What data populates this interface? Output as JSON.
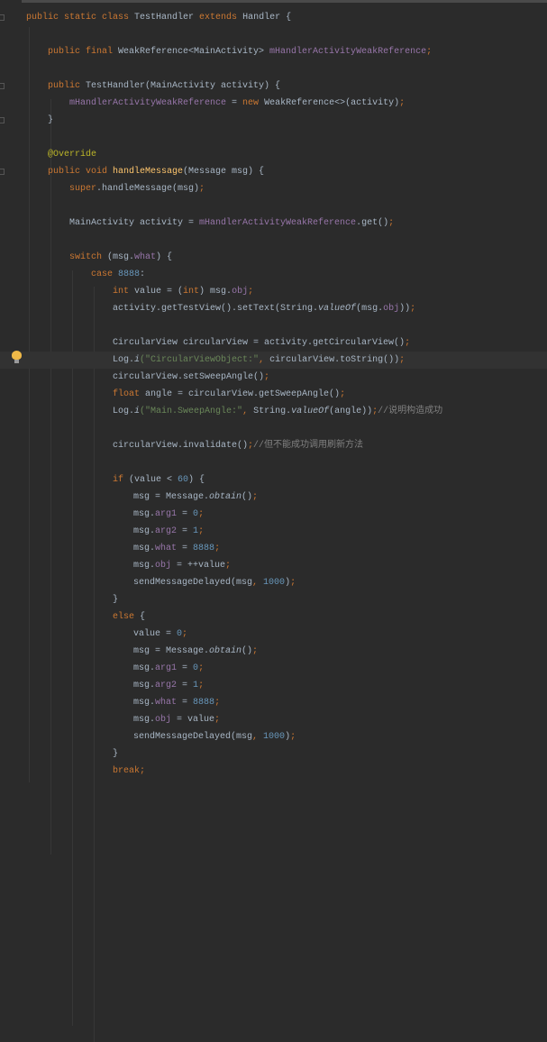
{
  "editor": {
    "highlighted_line": 21,
    "lines": [
      {
        "indent": 0,
        "fold": true,
        "tokens": [
          {
            "t": "public static class ",
            "c": "kw"
          },
          {
            "t": "TestHandler "
          },
          {
            "t": "extends ",
            "c": "kw"
          },
          {
            "t": "Handler {"
          }
        ]
      },
      {
        "indent": 0,
        "tokens": []
      },
      {
        "indent": 1,
        "tokens": [
          {
            "t": "public final ",
            "c": "kw"
          },
          {
            "t": "WeakReference<MainActivity> "
          },
          {
            "t": "mHandlerActivityWeakReference",
            "c": "fld"
          },
          {
            "t": ";",
            "c": "kw"
          }
        ]
      },
      {
        "indent": 0,
        "tokens": []
      },
      {
        "indent": 1,
        "fold": true,
        "tokens": [
          {
            "t": "public ",
            "c": "kw"
          },
          {
            "t": "TestHandler(MainActivity activity) {"
          }
        ]
      },
      {
        "indent": 2,
        "tokens": [
          {
            "t": "mHandlerActivityWeakReference",
            "c": "fld"
          },
          {
            "t": " = "
          },
          {
            "t": "new ",
            "c": "kw"
          },
          {
            "t": "WeakReference<>(activity)"
          },
          {
            "t": ";",
            "c": "kw"
          }
        ]
      },
      {
        "indent": 1,
        "fold": true,
        "tokens": [
          {
            "t": "}"
          }
        ]
      },
      {
        "indent": 0,
        "tokens": []
      },
      {
        "indent": 1,
        "tokens": [
          {
            "t": "@Override",
            "c": "ann"
          }
        ]
      },
      {
        "indent": 1,
        "fold": true,
        "tokens": [
          {
            "t": "public void ",
            "c": "kw"
          },
          {
            "t": "handleMessage",
            "c": "fn"
          },
          {
            "t": "(Message msg) {"
          }
        ]
      },
      {
        "indent": 2,
        "tokens": [
          {
            "t": "super",
            "c": "kw"
          },
          {
            "t": ".handleMessage(msg)"
          },
          {
            "t": ";",
            "c": "kw"
          }
        ]
      },
      {
        "indent": 0,
        "tokens": []
      },
      {
        "indent": 2,
        "tokens": [
          {
            "t": "MainActivity activity = "
          },
          {
            "t": "mHandlerActivityWeakReference",
            "c": "fld"
          },
          {
            "t": ".get()"
          },
          {
            "t": ";",
            "c": "kw"
          }
        ]
      },
      {
        "indent": 0,
        "tokens": []
      },
      {
        "indent": 2,
        "tokens": [
          {
            "t": "switch ",
            "c": "kw"
          },
          {
            "t": "(msg."
          },
          {
            "t": "what",
            "c": "fld"
          },
          {
            "t": ") {"
          }
        ]
      },
      {
        "indent": 3,
        "tokens": [
          {
            "t": "case ",
            "c": "kw"
          },
          {
            "t": "8888",
            "c": "num"
          },
          {
            "t": ":"
          }
        ]
      },
      {
        "indent": 4,
        "tokens": [
          {
            "t": "int ",
            "c": "kw"
          },
          {
            "t": "value = ("
          },
          {
            "t": "int",
            "c": "kw"
          },
          {
            "t": ") msg."
          },
          {
            "t": "obj",
            "c": "fld"
          },
          {
            "t": ";",
            "c": "kw"
          }
        ]
      },
      {
        "indent": 4,
        "tokens": [
          {
            "t": "activity.getTestView().setText(String."
          },
          {
            "t": "valueOf",
            "c": "it"
          },
          {
            "t": "(msg."
          },
          {
            "t": "obj",
            "c": "fld"
          },
          {
            "t": "))"
          },
          {
            "t": ";",
            "c": "kw"
          }
        ]
      },
      {
        "indent": 0,
        "tokens": []
      },
      {
        "indent": 4,
        "tokens": [
          {
            "t": "CircularView circularView = activity.getCircularView()"
          },
          {
            "t": ";",
            "c": "kw"
          }
        ]
      },
      {
        "indent": 4,
        "tokens": [
          {
            "t": "Log."
          },
          {
            "t": "i",
            "c": "it"
          },
          {
            "t": "(\"CircularViewObject:\"",
            "c": "str"
          },
          {
            "t": ", ",
            "c": "kw"
          },
          {
            "t": "circularView.toString())"
          },
          {
            "t": ";",
            "c": "kw"
          }
        ]
      },
      {
        "indent": 4,
        "tokens": [
          {
            "t": "circularView.setSweepAngle()"
          },
          {
            "t": ";",
            "c": "kw"
          }
        ]
      },
      {
        "indent": 4,
        "tokens": [
          {
            "t": "float ",
            "c": "kw"
          },
          {
            "t": "angle = circularView.getSweepAngle()"
          },
          {
            "t": ";",
            "c": "kw"
          }
        ]
      },
      {
        "indent": 4,
        "tokens": [
          {
            "t": "Log."
          },
          {
            "t": "i",
            "c": "it"
          },
          {
            "t": "(\"Main.SweepAngle:\"",
            "c": "str"
          },
          {
            "t": ", ",
            "c": "kw"
          },
          {
            "t": "String."
          },
          {
            "t": "valueOf",
            "c": "it"
          },
          {
            "t": "(angle))"
          },
          {
            "t": ";",
            "c": "kw"
          },
          {
            "t": "//说明构造成功",
            "c": "cmt"
          }
        ]
      },
      {
        "indent": 0,
        "tokens": []
      },
      {
        "indent": 4,
        "tokens": [
          {
            "t": "circularView.invalidate()"
          },
          {
            "t": ";",
            "c": "kw"
          },
          {
            "t": "//但不能成功调用刷新方法",
            "c": "cmt"
          }
        ]
      },
      {
        "indent": 0,
        "tokens": []
      },
      {
        "indent": 4,
        "tokens": [
          {
            "t": "if ",
            "c": "kw"
          },
          {
            "t": "(value < "
          },
          {
            "t": "60",
            "c": "num"
          },
          {
            "t": ") {"
          }
        ]
      },
      {
        "indent": 5,
        "tokens": [
          {
            "t": "msg = Message."
          },
          {
            "t": "obtain",
            "c": "it"
          },
          {
            "t": "()"
          },
          {
            "t": ";",
            "c": "kw"
          }
        ]
      },
      {
        "indent": 5,
        "tokens": [
          {
            "t": "msg."
          },
          {
            "t": "arg1",
            "c": "fld"
          },
          {
            "t": " = "
          },
          {
            "t": "0",
            "c": "num"
          },
          {
            "t": ";",
            "c": "kw"
          }
        ]
      },
      {
        "indent": 5,
        "tokens": [
          {
            "t": "msg."
          },
          {
            "t": "arg2",
            "c": "fld"
          },
          {
            "t": " = "
          },
          {
            "t": "1",
            "c": "num"
          },
          {
            "t": ";",
            "c": "kw"
          }
        ]
      },
      {
        "indent": 5,
        "tokens": [
          {
            "t": "msg."
          },
          {
            "t": "what",
            "c": "fld"
          },
          {
            "t": " = "
          },
          {
            "t": "8888",
            "c": "num"
          },
          {
            "t": ";",
            "c": "kw"
          }
        ]
      },
      {
        "indent": 5,
        "tokens": [
          {
            "t": "msg."
          },
          {
            "t": "obj",
            "c": "fld"
          },
          {
            "t": " = ++value"
          },
          {
            "t": ";",
            "c": "kw"
          }
        ]
      },
      {
        "indent": 5,
        "tokens": [
          {
            "t": "sendMessageDelayed(msg"
          },
          {
            "t": ", ",
            "c": "kw"
          },
          {
            "t": "1000",
            "c": "num"
          },
          {
            "t": ")"
          },
          {
            "t": ";",
            "c": "kw"
          }
        ]
      },
      {
        "indent": 4,
        "tokens": [
          {
            "t": "}"
          }
        ]
      },
      {
        "indent": 4,
        "tokens": [
          {
            "t": "else ",
            "c": "kw"
          },
          {
            "t": "{"
          }
        ]
      },
      {
        "indent": 5,
        "tokens": [
          {
            "t": "value = "
          },
          {
            "t": "0",
            "c": "num"
          },
          {
            "t": ";",
            "c": "kw"
          }
        ]
      },
      {
        "indent": 5,
        "tokens": [
          {
            "t": "msg = Message."
          },
          {
            "t": "obtain",
            "c": "it"
          },
          {
            "t": "()"
          },
          {
            "t": ";",
            "c": "kw"
          }
        ]
      },
      {
        "indent": 5,
        "tokens": [
          {
            "t": "msg."
          },
          {
            "t": "arg1",
            "c": "fld"
          },
          {
            "t": " = "
          },
          {
            "t": "0",
            "c": "num"
          },
          {
            "t": ";",
            "c": "kw"
          }
        ]
      },
      {
        "indent": 5,
        "tokens": [
          {
            "t": "msg."
          },
          {
            "t": "arg2",
            "c": "fld"
          },
          {
            "t": " = "
          },
          {
            "t": "1",
            "c": "num"
          },
          {
            "t": ";",
            "c": "kw"
          }
        ]
      },
      {
        "indent": 5,
        "tokens": [
          {
            "t": "msg."
          },
          {
            "t": "what",
            "c": "fld"
          },
          {
            "t": " = "
          },
          {
            "t": "8888",
            "c": "num"
          },
          {
            "t": ";",
            "c": "kw"
          }
        ]
      },
      {
        "indent": 5,
        "tokens": [
          {
            "t": "msg."
          },
          {
            "t": "obj",
            "c": "fld"
          },
          {
            "t": " = value"
          },
          {
            "t": ";",
            "c": "kw"
          }
        ]
      },
      {
        "indent": 5,
        "tokens": [
          {
            "t": "sendMessageDelayed(msg"
          },
          {
            "t": ", ",
            "c": "kw"
          },
          {
            "t": "1000",
            "c": "num"
          },
          {
            "t": ")"
          },
          {
            "t": ";",
            "c": "kw"
          }
        ]
      },
      {
        "indent": 4,
        "tokens": [
          {
            "t": "}"
          }
        ]
      },
      {
        "indent": 4,
        "tokens": [
          {
            "t": "break",
            "c": "kw"
          },
          {
            "t": ";",
            "c": "kw"
          }
        ]
      }
    ]
  }
}
